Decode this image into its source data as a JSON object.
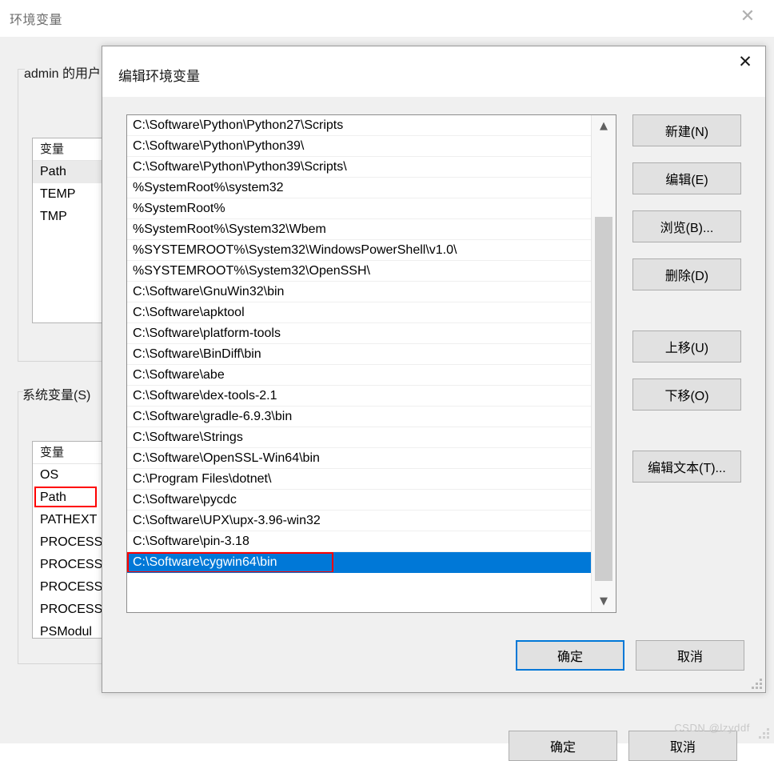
{
  "outer_window": {
    "title": "环境变量",
    "close_icon": "close-icon",
    "user_group_label": "admin 的用户变量",
    "system_group_label": "系统变量(S)",
    "column_header": "变量",
    "user_variables": [
      "Path",
      "TEMP",
      "TMP"
    ],
    "system_variables": [
      "OS",
      "Path",
      "PATHEXT",
      "PROCESS",
      "PROCESS",
      "PROCESS",
      "PROCESS",
      "PSModul"
    ],
    "ok_label": "确定",
    "cancel_label": "取消",
    "watermark": "CSDN @lzyddf"
  },
  "edit_dialog": {
    "title": "编辑环境变量",
    "close_icon": "close-icon",
    "paths": [
      "C:\\Software\\Python\\Python27\\Scripts",
      "C:\\Software\\Python\\Python39\\",
      "C:\\Software\\Python\\Python39\\Scripts\\",
      "%SystemRoot%\\system32",
      "%SystemRoot%",
      "%SystemRoot%\\System32\\Wbem",
      "%SYSTEMROOT%\\System32\\WindowsPowerShell\\v1.0\\",
      "%SYSTEMROOT%\\System32\\OpenSSH\\",
      "C:\\Software\\GnuWin32\\bin",
      "C:\\Software\\apktool",
      "C:\\Software\\platform-tools",
      "C:\\Software\\BinDiff\\bin",
      "C:\\Software\\abe",
      "C:\\Software\\dex-tools-2.1",
      "C:\\Software\\gradle-6.9.3\\bin",
      "C:\\Software\\Strings",
      "C:\\Software\\OpenSSL-Win64\\bin",
      "C:\\Program Files\\dotnet\\",
      "C:\\Software\\pycdc",
      "C:\\Software\\UPX\\upx-3.96-win32",
      "C:\\Software\\pin-3.18",
      "C:\\Software\\cygwin64\\bin"
    ],
    "selected_index": 21,
    "scrollbar": {
      "up_icon": "chevron-up-icon",
      "down_icon": "chevron-down-icon"
    },
    "side_buttons": [
      "新建(N)",
      "编辑(E)",
      "浏览(B)...",
      "删除(D)",
      "上移(U)",
      "下移(O)",
      "编辑文本(T)..."
    ],
    "ok_label": "确定",
    "cancel_label": "取消"
  },
  "colors": {
    "accent": "#0078d7",
    "annotation": "#ff0000",
    "dialog_bg": "#f0f0f0",
    "button_bg": "#e1e1e1"
  }
}
